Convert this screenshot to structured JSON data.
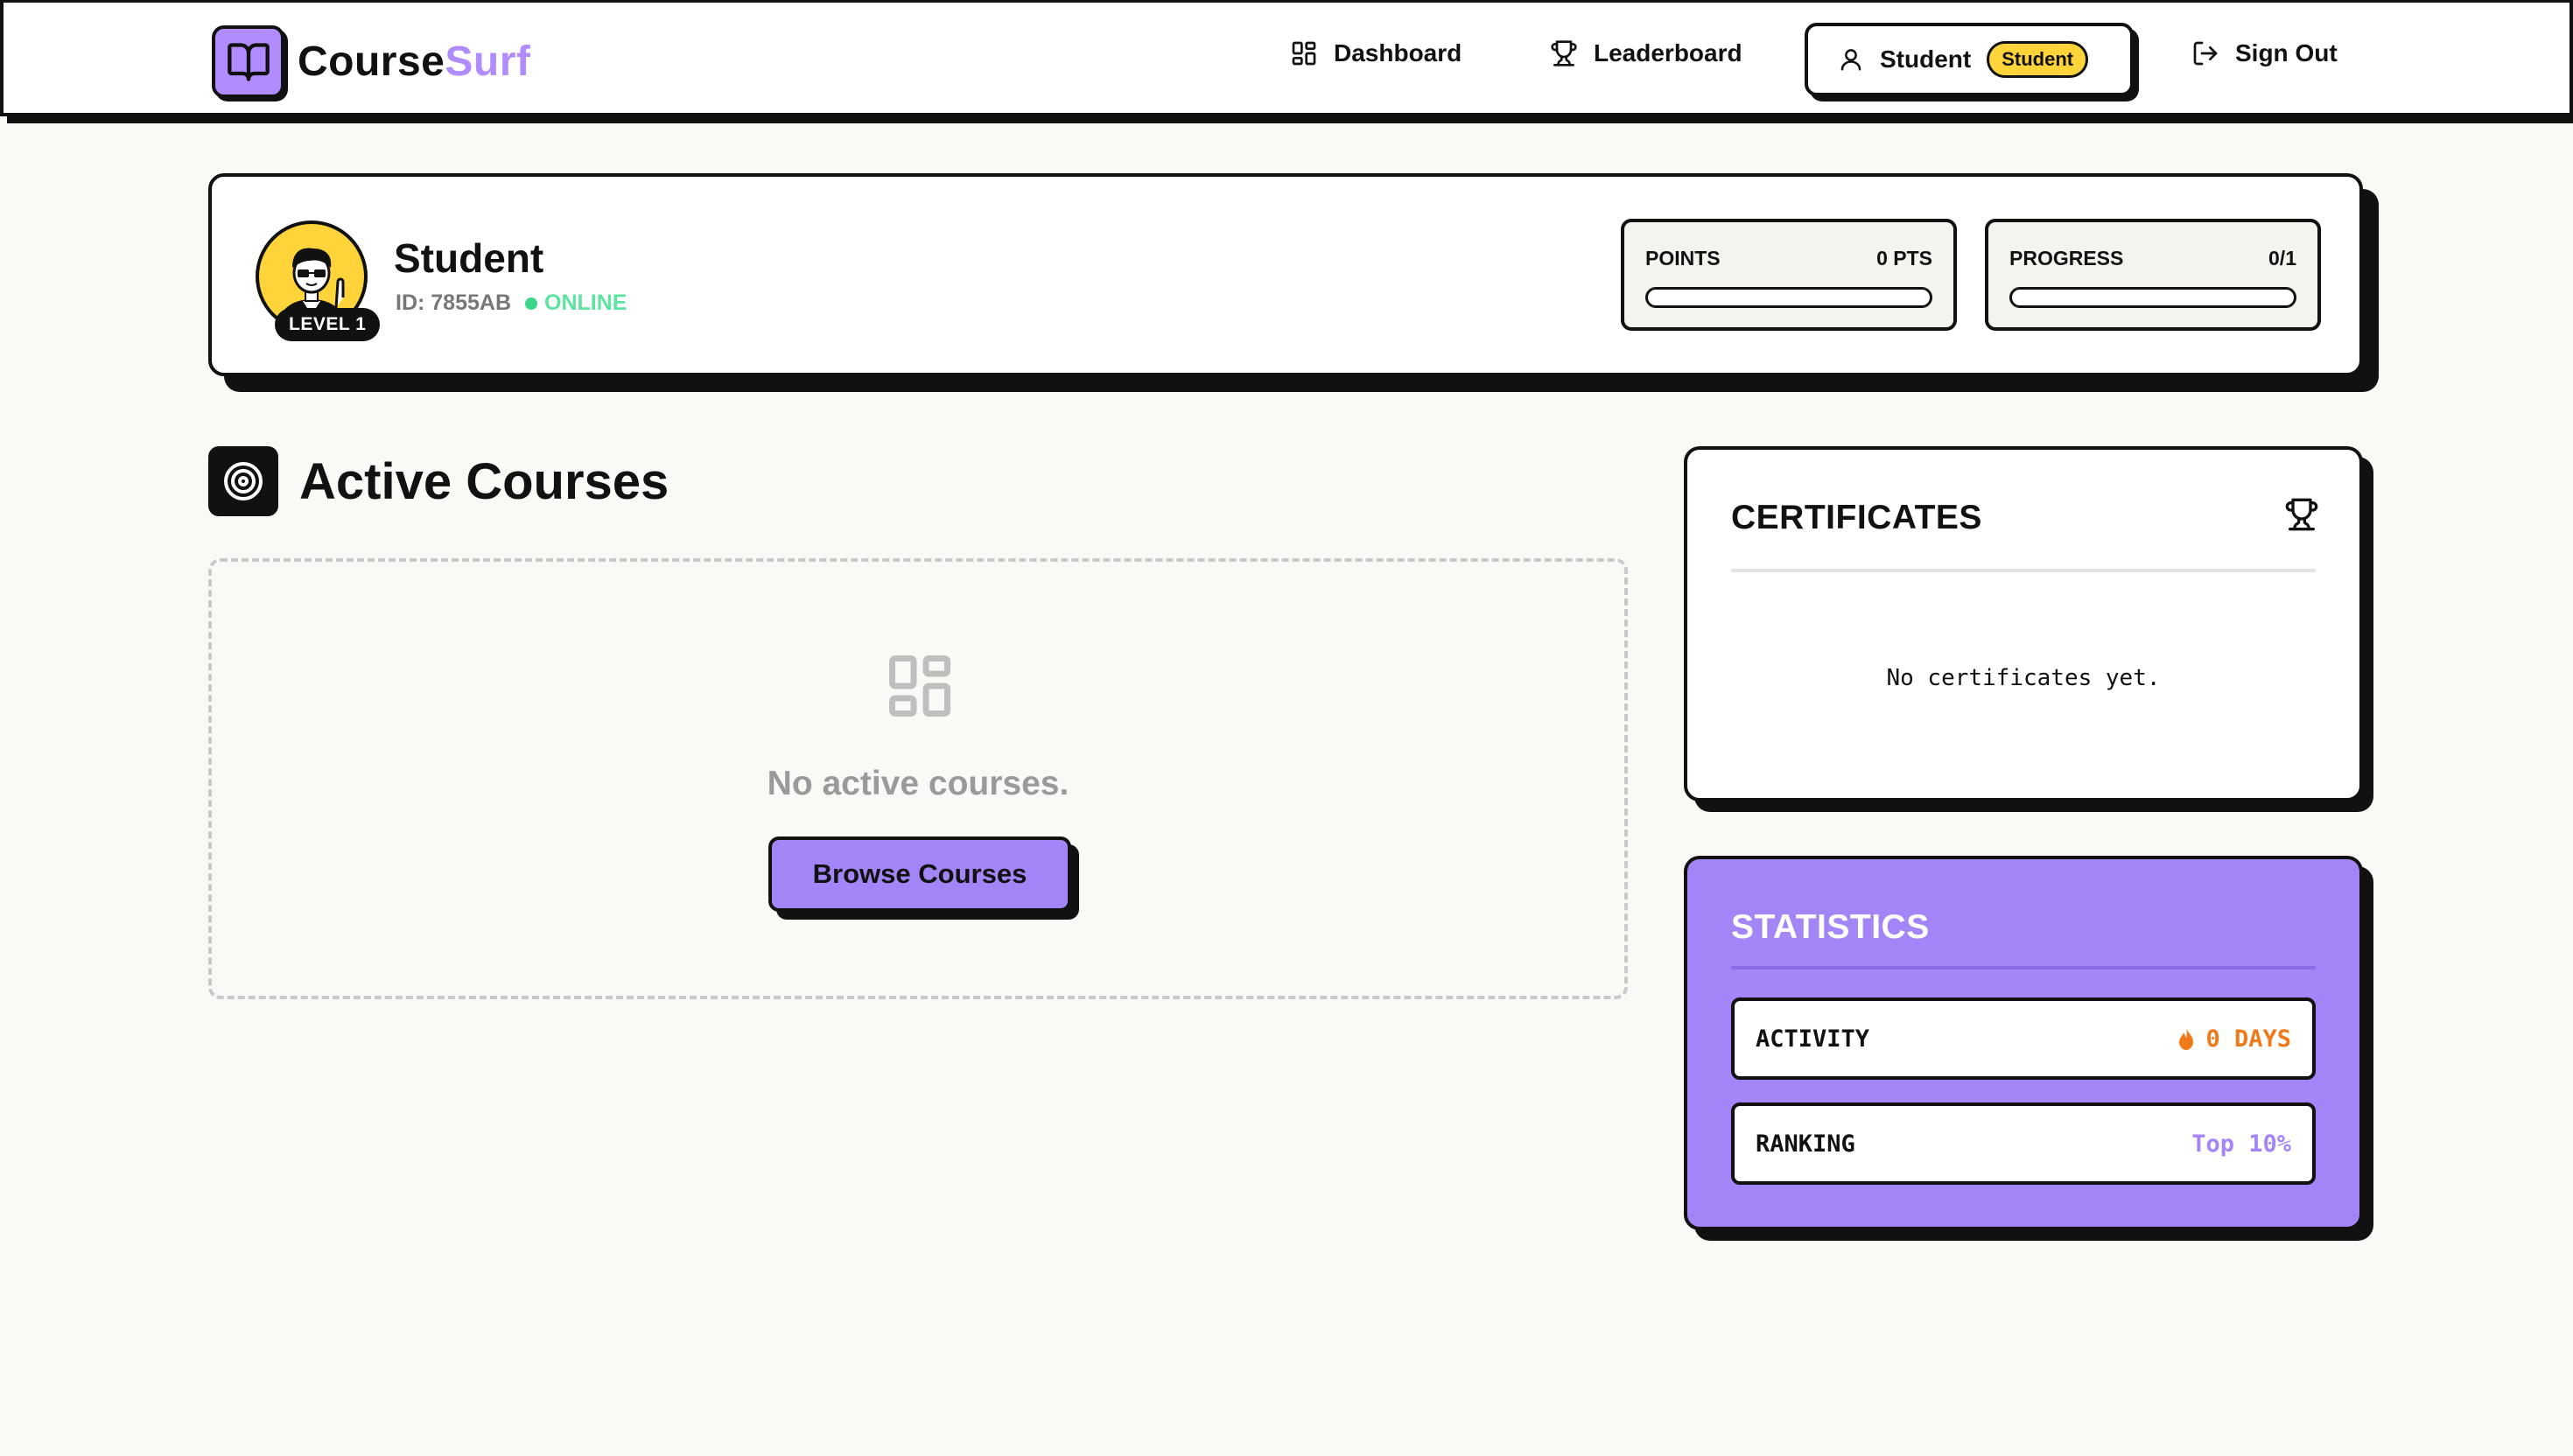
{
  "brand": {
    "name_main": "Course",
    "name_accent": "Surf"
  },
  "nav": {
    "dashboard": "Dashboard",
    "leaderboard": "Leaderboard",
    "user_name": "Student",
    "role_badge": "Student",
    "sign_out": "Sign Out"
  },
  "profile": {
    "name": "Student",
    "id_label": "ID: 7855AB",
    "status": "ONLINE",
    "level": "LEVEL 1",
    "points": {
      "label": "POINTS",
      "value": "0 PTS",
      "fill_fraction": 0
    },
    "progress": {
      "label": "PROGRESS",
      "value": "0/1",
      "fill_fraction": 0
    }
  },
  "courses": {
    "title": "Active Courses",
    "empty_text": "No active courses.",
    "browse_button": "Browse Courses"
  },
  "certificates": {
    "title": "CERTIFICATES",
    "empty_text": "No certificates yet."
  },
  "statistics": {
    "title": "STATISTICS",
    "activity": {
      "label": "ACTIVITY",
      "value": "0 DAYS"
    },
    "ranking": {
      "label": "RANKING",
      "value": "Top 10%"
    }
  },
  "colors": {
    "accent_purple": "#a385f7",
    "accent_yellow": "#ffd43b",
    "online_green": "#5fe3a0",
    "streak_orange": "#f07a1a"
  }
}
